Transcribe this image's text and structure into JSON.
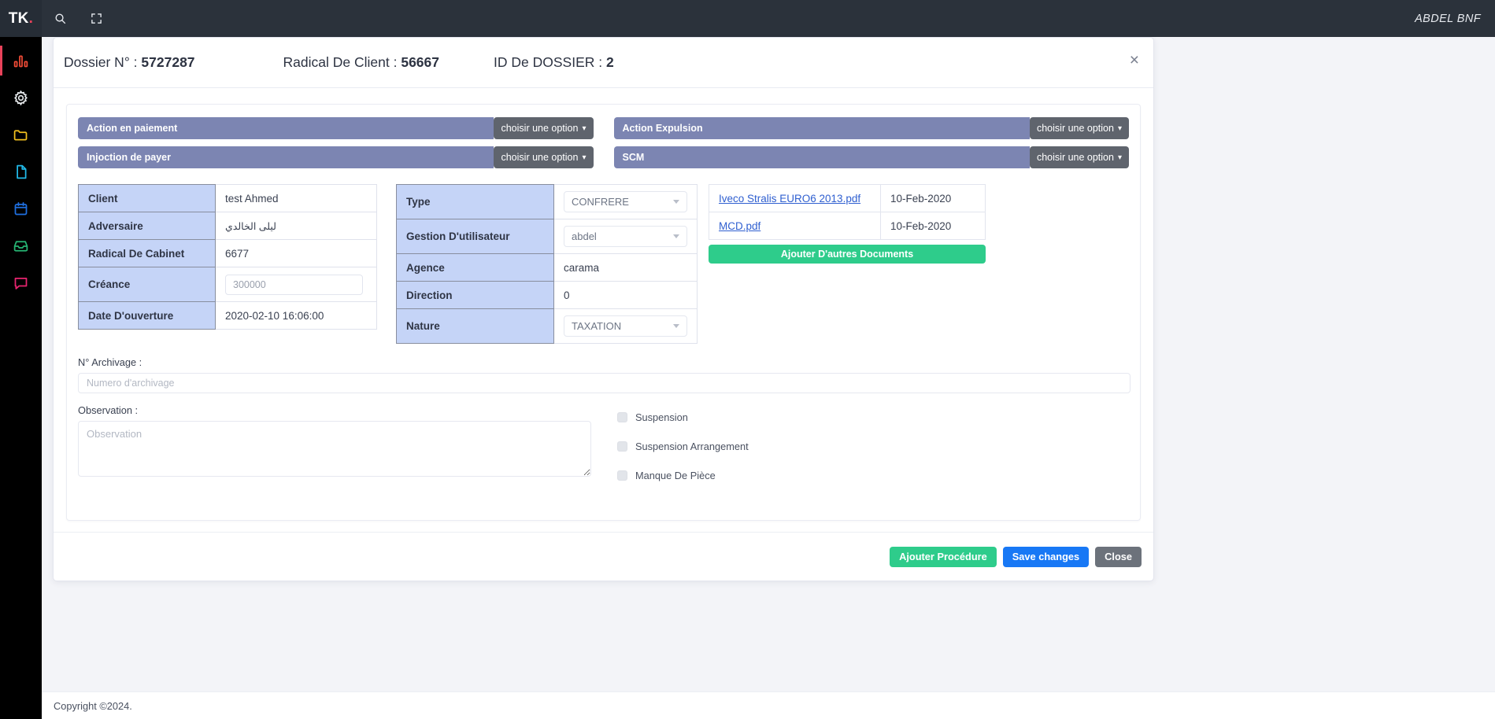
{
  "topbar": {
    "brand": "TK",
    "brand_dot": ".",
    "search_icon": "search-icon",
    "fullscreen_icon": "fullscreen-icon",
    "user": "ABDEL BNF"
  },
  "rail": {
    "items": [
      {
        "icon": "bar-chart-icon",
        "color": "#ef4b36",
        "active": true
      },
      {
        "icon": "gear-icon",
        "color": "#e9ecef",
        "active": false
      },
      {
        "icon": "folder-icon",
        "color": "#f2c01e",
        "active": false
      },
      {
        "icon": "file-icon",
        "color": "#21b9e8",
        "active": false
      },
      {
        "icon": "calendar-icon",
        "color": "#1f6fe0",
        "active": false
      },
      {
        "icon": "inbox-icon",
        "color": "#26b573",
        "active": false
      },
      {
        "icon": "chat-icon",
        "color": "#e8246f",
        "active": false
      }
    ]
  },
  "header": {
    "dossier_label": "Dossier N° : ",
    "dossier_value": "5727287",
    "radical_label": "Radical De Client : ",
    "radical_value": "56667",
    "id_label": "ID De DOSSIER : ",
    "id_value": "2",
    "close_icon": "×"
  },
  "actions": {
    "left": [
      {
        "label": "Action en paiement",
        "select": "choisir une option"
      },
      {
        "label": "Injoction de payer",
        "select": "choisir une option"
      }
    ],
    "right": [
      {
        "label": "Action Expulsion",
        "select": "choisir une option"
      },
      {
        "label": "SCM",
        "select": "choisir une option"
      }
    ]
  },
  "info_table": {
    "rows": [
      {
        "key": "Client",
        "value": "test Ahmed",
        "type": "text"
      },
      {
        "key": "Adversaire",
        "value": "ليلى الخالدي",
        "type": "arabic"
      },
      {
        "key": "Radical De Cabinet",
        "value": "6677",
        "type": "text"
      },
      {
        "key": "Créance",
        "value": "300000",
        "type": "input"
      },
      {
        "key": "Date D'ouverture",
        "value": "2020-02-10 16:06:00",
        "type": "text"
      }
    ]
  },
  "detail_table": {
    "rows": [
      {
        "key": "Type",
        "value": "CONFRERE",
        "type": "select"
      },
      {
        "key": "Gestion D'utilisateur",
        "value": "abdel",
        "type": "select"
      },
      {
        "key": "Agence",
        "value": "carama",
        "type": "text"
      },
      {
        "key": "Direction",
        "value": "0",
        "type": "text"
      },
      {
        "key": "Nature",
        "value": "TAXATION",
        "type": "select"
      }
    ]
  },
  "documents": {
    "rows": [
      {
        "name": "Iveco Stralis EURO6 2013.pdf",
        "date": "10-Feb-2020"
      },
      {
        "name": "MCD.pdf",
        "date": "10-Feb-2020"
      }
    ],
    "add_button": "Ajouter D'autres Documents"
  },
  "archivage": {
    "label": "N° Archivage :",
    "placeholder": "Numero d'archivage",
    "value": ""
  },
  "observation": {
    "label": "Observation :",
    "placeholder": "Observation",
    "value": ""
  },
  "checkboxes": [
    {
      "label": "Suspension",
      "checked": false
    },
    {
      "label": "Suspension Arrangement",
      "checked": false
    },
    {
      "label": "Manque De Pièce",
      "checked": false
    }
  ],
  "footer": {
    "add_procedure": "Ajouter Procédure",
    "save": "Save changes",
    "close": "Close"
  },
  "copyright": "Copyright ©2024.",
  "colors": {
    "action_label_bg": "#7c85b2",
    "action_select_bg": "#5f646d",
    "table_key_bg": "#c5d4f7",
    "green": "#2ecc8b",
    "blue": "#1878f5",
    "gray": "#6c727b",
    "link": "#2f5fd0",
    "topbar": "#2b323b",
    "rail": "#000000"
  }
}
